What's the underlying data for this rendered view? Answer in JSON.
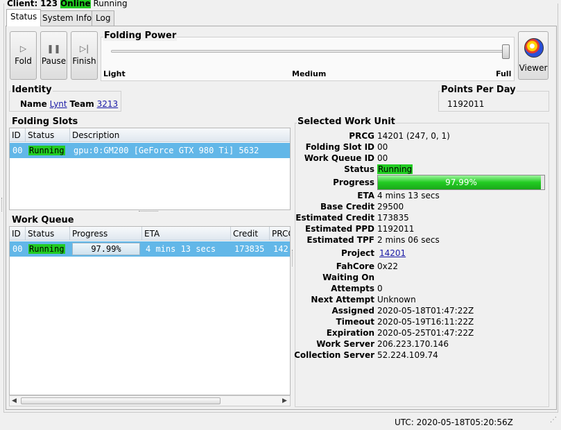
{
  "client": {
    "label": "Client:",
    "name": "123",
    "online": "Online",
    "state": "Running"
  },
  "tabs": [
    {
      "label": "Status",
      "active": true
    },
    {
      "label": "System Info",
      "active": false
    },
    {
      "label": "Log",
      "active": false
    }
  ],
  "toolbar": {
    "fold_label": "Fold",
    "pause_label": "Pause",
    "finish_label": "Finish",
    "fold_icon": "play-icon",
    "pause_icon": "pause-icon",
    "finish_icon": "finish-icon"
  },
  "folding_power": {
    "title": "Folding Power",
    "light": "Light",
    "medium": "Medium",
    "full": "Full",
    "level": 1.0
  },
  "viewer": {
    "label": "Viewer",
    "icon": "protein-viewer-icon"
  },
  "identity": {
    "title": "Identity",
    "name_label": "Name",
    "name_value": "Lynt",
    "team_label": "Team",
    "team_value": "3213"
  },
  "ppd": {
    "title": "Points Per Day",
    "value": "1192011"
  },
  "folding_slots": {
    "title": "Folding Slots",
    "columns": [
      "ID",
      "Status",
      "Description"
    ],
    "rows": [
      {
        "id": "00",
        "status": "Running",
        "description": "gpu:0:GM200 [GeForce GTX 980 Ti] 5632"
      }
    ]
  },
  "work_queue": {
    "title": "Work Queue",
    "columns": [
      "ID",
      "Status",
      "Progress",
      "ETA",
      "Credit",
      "PRCG"
    ],
    "rows": [
      {
        "id": "00",
        "status": "Running",
        "progress": "97.99%",
        "eta": "4 mins 13 secs",
        "credit": "173835",
        "prcg": "142"
      }
    ]
  },
  "selected_work_unit": {
    "title": "Selected Work Unit",
    "fields": {
      "prcg": {
        "label": "PRCG",
        "value": "14201 (247, 0, 1)"
      },
      "folding_slot_id": {
        "label": "Folding Slot ID",
        "value": "00"
      },
      "work_queue_id": {
        "label": "Work Queue ID",
        "value": "00"
      },
      "status": {
        "label": "Status",
        "value": "Running"
      },
      "progress": {
        "label": "Progress",
        "value": "97.99%",
        "fraction": 0.9799
      },
      "eta": {
        "label": "ETA",
        "value": "4 mins 13 secs"
      },
      "base_credit": {
        "label": "Base Credit",
        "value": "29500"
      },
      "estimated_credit": {
        "label": "Estimated Credit",
        "value": "173835"
      },
      "estimated_ppd": {
        "label": "Estimated PPD",
        "value": "1192011"
      },
      "estimated_tpf": {
        "label": "Estimated TPF",
        "value": "2 mins 06 secs"
      },
      "project": {
        "label": "Project",
        "value": "14201"
      },
      "fahcore": {
        "label": "FahCore",
        "value": "0x22"
      },
      "waiting_on": {
        "label": "Waiting On",
        "value": ""
      },
      "attempts": {
        "label": "Attempts",
        "value": "0"
      },
      "next_attempt": {
        "label": "Next Attempt",
        "value": "Unknown"
      },
      "assigned": {
        "label": "Assigned",
        "value": "2020-05-18T01:47:22Z"
      },
      "timeout": {
        "label": "Timeout",
        "value": "2020-05-19T16:11:22Z"
      },
      "expiration": {
        "label": "Expiration",
        "value": "2020-05-25T01:47:22Z"
      },
      "work_server": {
        "label": "Work Server",
        "value": "206.223.170.146"
      },
      "collection_server": {
        "label": "Collection Server",
        "value": "52.224.109.74"
      }
    }
  },
  "statusbar": {
    "utc": "UTC: 2020-05-18T05:20:56Z"
  },
  "colors": {
    "online_green": "#22cc22",
    "selection_blue": "#62b7e8",
    "link_blue": "#1a1aa6"
  }
}
